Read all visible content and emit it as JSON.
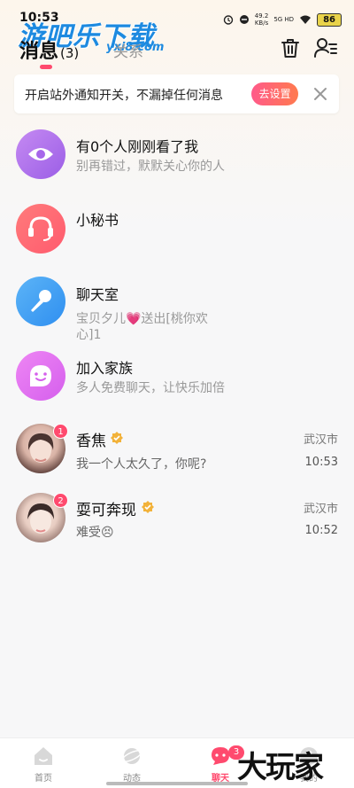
{
  "status_bar": {
    "time": "10:53",
    "speed": "49.2",
    "speed_unit": "KB/s",
    "network": "5G HD",
    "battery": "86"
  },
  "watermark": {
    "text": "游吧乐下载",
    "sub": "yxi8.com"
  },
  "header": {
    "tab_messages": "消息",
    "tab_messages_count": "(3)",
    "tab_relations": "关系"
  },
  "notice": {
    "text": "开启站外通知开关，不漏掉任何消息",
    "button": "去设置"
  },
  "list": [
    {
      "title": "有0个人刚刚看了我",
      "subtitle": "别再错过，默默关心你的人",
      "icon": "eye-icon",
      "color": "#b06ee8"
    },
    {
      "title": "小秘书",
      "subtitle": "",
      "icon": "headset-icon",
      "color": "#ff6a6a"
    },
    {
      "title": "聊天室",
      "subtitle_line1": "宝贝夕儿💗送出[桃你欢",
      "subtitle_line2": "心]1",
      "icon": "microphone-icon",
      "color": "#3c9ff2"
    },
    {
      "title": "加入家族",
      "subtitle": "多人免费聊天，让快乐加倍",
      "icon": "smile-icon",
      "color": "#e36bf2"
    }
  ],
  "chats": [
    {
      "name": "香焦",
      "message": "我一个人太久了，你呢?",
      "city": "武汉市",
      "time": "10:53",
      "unread": "1"
    },
    {
      "name": "耍可奔现",
      "message": "难受😣",
      "city": "武汉市",
      "time": "10:52",
      "unread": "2"
    }
  ],
  "bottom_nav": {
    "items": [
      {
        "label": "首页",
        "icon": "home-icon"
      },
      {
        "label": "动态",
        "icon": "planet-icon"
      },
      {
        "label": "聊天",
        "icon": "chat-icon"
      },
      {
        "label": "我的",
        "icon": "profile-icon"
      }
    ],
    "chat_badge": "3",
    "active_color": "#ff4a6e"
  },
  "corner_logo": "大玩家"
}
